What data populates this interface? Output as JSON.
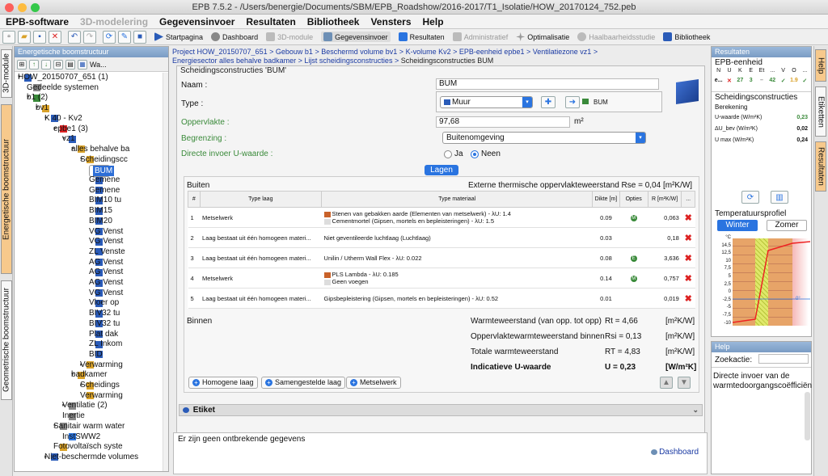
{
  "window": {
    "title": "EPB 7.5.2 - /Users/benergie/Documents/SBM/EPB_Roadshow/2016-2017/T1_Isolatie/HOW_20170124_752.peb"
  },
  "menu": [
    "EPB-software",
    "3D-modelering",
    "Gegevensinvoer",
    "Resultaten",
    "Bibliotheek",
    "Vensters",
    "Help"
  ],
  "toolbar": {
    "buttons": [
      "Startpagina",
      "Dashboard",
      "3D-module",
      "Gegevensinvoer",
      "Resultaten",
      "Administratief",
      "Optimalisatie",
      "Haalbaarheidsstudie",
      "Bibliotheek"
    ]
  },
  "left_tabs": [
    "3D-module",
    "Energetische boomstructuur",
    "Geometrische boomstructuur"
  ],
  "tree": {
    "header": "Energetische boomstructuur",
    "search_label": "Wa...",
    "nodes": [
      "HOW_20150707_651 (1)",
      "Gedeelde systemen",
      "b1 (2)",
      "bv1",
      "K 40 - Kv2",
      "epbe1 (3)",
      "vz1",
      "alles behalve ba",
      "Scheidingscc",
      "BUM",
      "Gemene",
      "Gemene",
      "BIM10 tu",
      "BIM15",
      "BIM20",
      "VG Venst",
      "VG Venst",
      "ZL Venste",
      "AG Venst",
      "AG Venst",
      "AG Venst",
      "VG Venst",
      "Vloer op",
      "BIV32 tu",
      "BIV32 tu",
      "Plat dak",
      "ZL Inkom",
      "BID",
      "Verwarming",
      "badkamer",
      "Scheidings",
      "Verwarming",
      "Ventilatie (2)",
      "Inertie",
      "Sanitair warm water",
      "InstSWW2",
      "Fotovoltaïsch syste",
      "Niet-beschermde volumes"
    ]
  },
  "breadcrumb": {
    "line1": [
      "Project HOW_20150707_651",
      "Gebouw b1",
      "Beschermd volume bv1",
      "K-volume Kv2",
      "EPB-eenheid epbe1",
      "Ventilatiezone vz1"
    ],
    "line2": [
      "Energiesector alles behalve badkamer",
      "Lijst scheidingsconstructies"
    ],
    "current": "Scheidingsconstructies BUM",
    "sep": ">"
  },
  "form": {
    "title": "Scheidingsconstructies 'BUM'",
    "naam_label": "Naam :",
    "naam_value": "BUM",
    "type_label": "Type :",
    "type_value": "Muur",
    "type_ref": "BUM",
    "oppervlakte_label": "Oppervlakte :",
    "oppervlakte_value": "97,68",
    "oppervlakte_unit": "m²",
    "begrenzing_label": "Begrenzing :",
    "begrenzing_value": "Buitenomgeving",
    "uwaarde_label": "Directe invoer U-waarde :",
    "ja": "Ja",
    "neen": "Neen",
    "lagen_tab": "Lagen",
    "buiten": "Buiten",
    "rse_text": "Externe thermische oppervlakteweerstand  Rse = 0,04  [m²K/W]",
    "binnen": "Binnen"
  },
  "layers": {
    "headers": [
      "#",
      "Type laag",
      "Type materiaal",
      "Dikte [m]",
      "Opties",
      "R [m²K/W]",
      "..."
    ],
    "rows": [
      {
        "n": "1",
        "type": "Metselwerk",
        "mat": [
          "Stenen van gebakken aarde (Elementen van metselwerk) - λU: 1.4",
          "Cementmortel (Gipsen, mortels en bepleisteringen) - λU: 1.5"
        ],
        "d": "0.09",
        "opt": "M",
        "r": "0,063"
      },
      {
        "n": "2",
        "type": "Laag bestaat uit één homogeen materi...",
        "mat": [
          "Niet geventileerde luchtlaag (Luchtlaag)"
        ],
        "d": "0.03",
        "opt": "",
        "r": "0,18"
      },
      {
        "n": "3",
        "type": "Laag bestaat uit één homogeen materi...",
        "mat": [
          "Unilin / Utherm Wall Flex - λU: 0.022"
        ],
        "d": "0.08",
        "opt": "E",
        "r": "3,636"
      },
      {
        "n": "4",
        "type": "Metselwerk",
        "mat": [
          "PLS Lambda - λU: 0.185",
          "Geen voegen"
        ],
        "d": "0.14",
        "opt": "M",
        "r": "0,757"
      },
      {
        "n": "5",
        "type": "Laag bestaat uit één homogeen materi...",
        "mat": [
          "Gipsbepleistering (Gipsen, mortels en bepleisteringen) - λU: 0.52"
        ],
        "d": "0.01",
        "opt": "",
        "r": "0,019"
      }
    ]
  },
  "summary": [
    {
      "label": "Warmteweerstand (van opp. tot opp)",
      "sym": "Rt = 4,66",
      "unit": "[m²K/W]",
      "bold": false
    },
    {
      "label": "Oppervlaktewarmteweerstand binnen",
      "sym": "Rsi = 0,13",
      "unit": "[m²K/W]",
      "bold": false
    },
    {
      "label": "Totale warmteweerstand",
      "sym": "RT = 4,83",
      "unit": "[m²K/W]",
      "bold": false
    },
    {
      "label": "Indicatieve U-waarde",
      "sym": "U = 0,23",
      "unit": "[W/m²K]",
      "bold": true
    }
  ],
  "add_buttons": [
    "Homogene laag",
    "Samengestelde laag",
    "Metselwerk"
  ],
  "etiket": "Etiket",
  "status": {
    "message": "Er zijn geen ontbrekende gegevens",
    "dashboard": "Dashboard"
  },
  "results": {
    "header": "Resultaten",
    "unit_title": "EPB-eenheid",
    "cols": [
      "N",
      "U",
      "K",
      "E",
      "Et",
      "...",
      "V",
      "O",
      "..."
    ],
    "vals": [
      "e...",
      "✕",
      "27",
      "3",
      "–",
      "42",
      "✓",
      "1.9",
      "✓"
    ],
    "sc_title": "Scheidingsconstructies",
    "berekening": "Berekening",
    "rows": [
      {
        "label": "U-waarde (W/m²K)",
        "value": "0,23",
        "green": true
      },
      {
        "label": "ΔU_bev (W/m²K)",
        "value": "0,02",
        "green": false
      },
      {
        "label": "U max (W/m²K)",
        "value": "0,24",
        "green": false
      }
    ]
  },
  "temp": {
    "title": "Temperatuursprofiel",
    "winter": "Winter",
    "zomer": "Zomer",
    "ticks": [
      "°C",
      "14,5",
      "12,5",
      "10",
      "7,5",
      "5",
      "2,5",
      "0",
      "-2,5",
      "-5",
      "-7,5",
      "-10"
    ],
    "zero": "0°"
  },
  "help": {
    "header": "Help",
    "search_label": "Zoekactie:",
    "text": "Directe invoer van de warmtedoorgangscoëfficiën"
  },
  "right_tabs": [
    "Help",
    "Etiketten",
    "Resultaten"
  ]
}
